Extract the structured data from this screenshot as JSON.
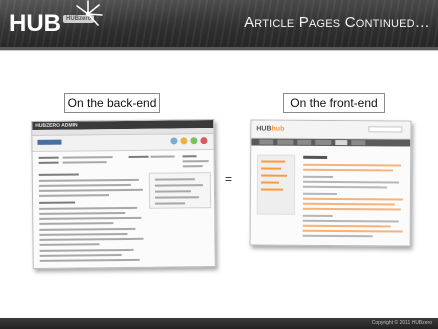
{
  "header": {
    "logo_text": "HUB",
    "logo_sub": "HUBzero",
    "slide_title": "Article Pages Continued…"
  },
  "captions": {
    "back_end": "On the back-end",
    "front_end": "On the front-end",
    "equals": "="
  },
  "screenshots": {
    "back_end": {
      "app_title": "HUBZERO ADMIN"
    },
    "front_end": {
      "logo_prefix": "HUB",
      "logo_suffix": "hub"
    }
  },
  "footer": {
    "copyright": "Copyright © 2011 HUBzero"
  },
  "colors": {
    "header_bg": "#2f2f2f",
    "accent_orange": "#ff9a3c",
    "footer_bg": "#222222"
  }
}
